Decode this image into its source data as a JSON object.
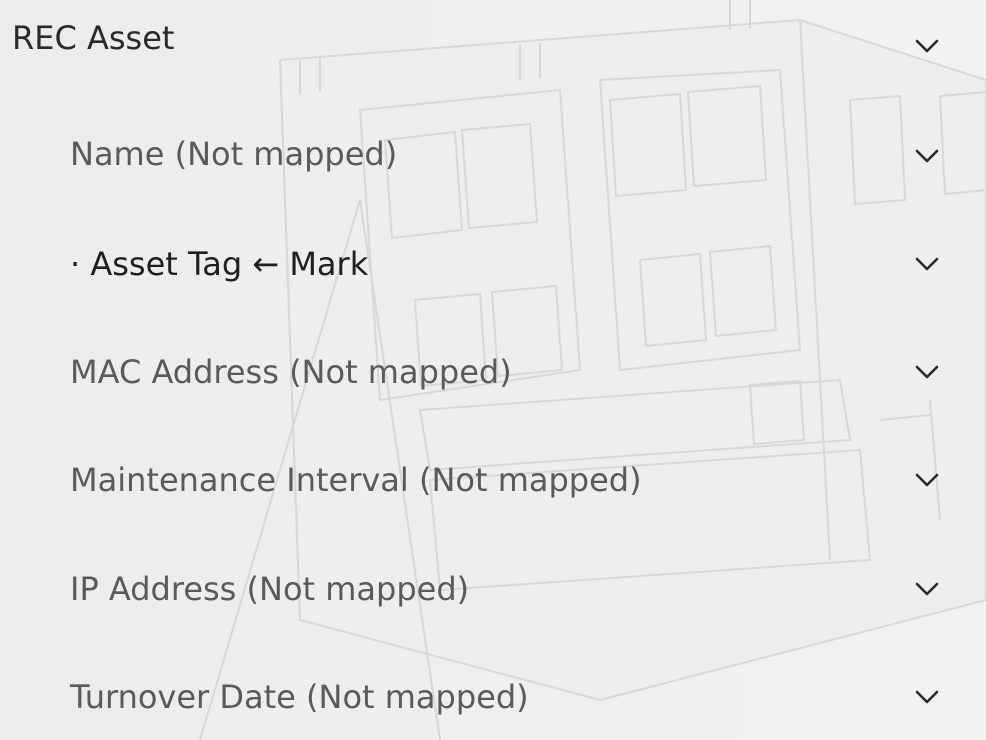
{
  "section": {
    "title": "REC Asset"
  },
  "fields": [
    {
      "label": "Name (Not mapped)",
      "mapped": false
    },
    {
      "label": "· Asset Tag ← Mark",
      "mapped": true
    },
    {
      "label": "MAC Address (Not mapped)",
      "mapped": false
    },
    {
      "label": "Maintenance Interval (Not mapped)",
      "mapped": false
    },
    {
      "label": "IP Address (Not mapped)",
      "mapped": false
    },
    {
      "label": "Turnover Date (Not mapped)",
      "mapped": false
    }
  ],
  "icons": {
    "expand": "chevron-down-icon"
  },
  "colors": {
    "background": "#ececec",
    "header_text": "#2a2a2a",
    "unmapped_text": "#5a5a5a",
    "mapped_text": "#1f1f1f"
  }
}
